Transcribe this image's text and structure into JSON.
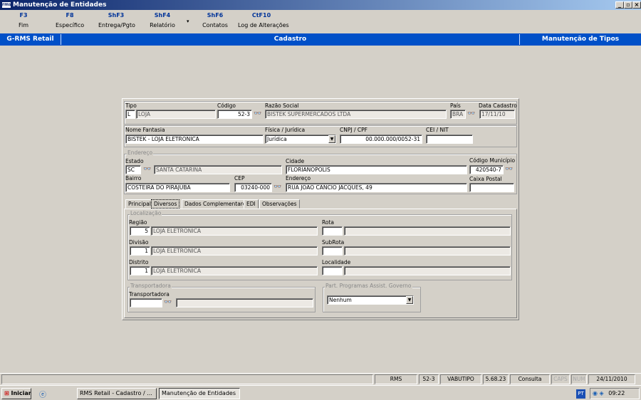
{
  "window": {
    "title": "Manutenção de Entidades",
    "logo": "rms"
  },
  "toolbar": [
    {
      "key": "F3",
      "label": "Fim"
    },
    {
      "key": "F8",
      "label": "Específico"
    },
    {
      "key": "ShF3",
      "label": "Entrega/Pgto"
    },
    {
      "key": "ShF4",
      "label": "Relatório"
    },
    {
      "key": "ShF6",
      "label": "Contatos"
    },
    {
      "key": "CtF10",
      "label": "Log de Alterações"
    }
  ],
  "header": {
    "left": "G-RMS Retail",
    "center": "Cadastro",
    "right": "Manutenção de Tipos"
  },
  "form": {
    "tipo_label": "Tipo",
    "tipo_code": "L",
    "tipo_desc": "LOJA",
    "codigo_label": "Código",
    "codigo": "52-3",
    "razao_label": "Razão Social",
    "razao": "BISTEK SUPERMERCADOS LTDA",
    "pais_label": "País",
    "pais": "BRA",
    "data_cad_label": "Data Cadastro",
    "data_cad": "17/11/10",
    "fantasia_label": "Nome Fantasia",
    "fantasia": "BISTEK - LOJA ELETRONICA",
    "fisjur_label": "Física / Jurídica",
    "fisjur": "Jurídica",
    "cnpj_label": "CNPJ / CPF",
    "cnpj": "00.000.000/0052-31",
    "cei_label": "CEI / NIT",
    "cei": "",
    "endereco_group": "Endereço",
    "estado_label": "Estado",
    "estado_code": "SC",
    "estado_desc": "SANTA CATARINA",
    "cidade_label": "Cidade",
    "cidade": "FLORIANOPOLIS",
    "cod_mun_label": "Código Município",
    "cod_mun": "420540-7",
    "bairro_label": "Bairro",
    "bairro": "COSTEIRA DO PIRAJUBA",
    "cep_label": "CEP",
    "cep": "03240-000",
    "endereco_label": "Endereço",
    "endereco": "RUA JOAO CANCIO JACQUES, 49",
    "cx_postal_label": "Caixa Postal",
    "cx_postal": ""
  },
  "tabs": [
    "Principal",
    "Diversos",
    "Dados Complementares",
    "EDI",
    "Observações"
  ],
  "diversos": {
    "localizacao_group": "Localização",
    "regiao_label": "Região",
    "regiao_code": "5",
    "regiao_desc": "LOJA ELETRONICA",
    "divisao_label": "Divisão",
    "divisao_code": "1",
    "divisao_desc": "LOJA ELETRONICA",
    "distrito_label": "Distrito",
    "distrito_code": "1",
    "distrito_desc": "LOJA ELETRONICA",
    "rota_label": "Rota",
    "subrota_label": "SubRota",
    "localidade_label": "Localidade",
    "transp_group": "Transportadora",
    "transp_label": "Transportadora",
    "prog_group": "Part. Programas Assist. Governo",
    "prog_value": "Nenhum"
  },
  "status": [
    "RMS",
    "52-3",
    "VABUTIPO",
    "5.68.23",
    "Consulta",
    "CAPS",
    "NUM",
    "24/11/2010"
  ],
  "taskbar": {
    "start": "Iniciar",
    "buttons": [
      "RMS Retail - Cadastro / ...",
      "Manutenção de Entidades"
    ],
    "lang": "PT",
    "clock": "09:22"
  }
}
